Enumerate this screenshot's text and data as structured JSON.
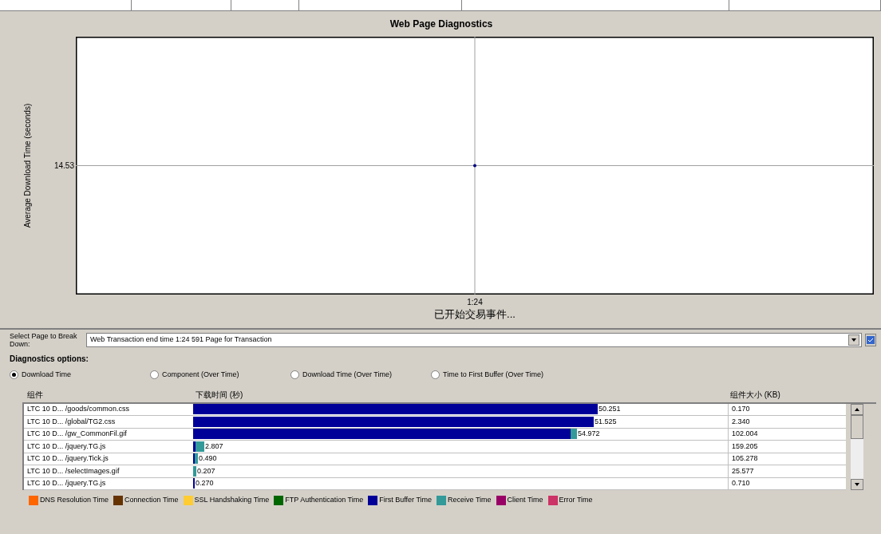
{
  "chart": {
    "title": "Web Page Diagnostics",
    "ylabel": "Average Download Time (seconds)",
    "ytick": "14.53",
    "xtick": "1:24",
    "xlabel": "已开始交易事件..."
  },
  "select_page": {
    "label": "Select Page to Break Down:",
    "value": "Web Transaction end time 1:24 591 Page for Transaction"
  },
  "options": {
    "title": "Diagnostics options:",
    "radios": [
      {
        "label": "Download Time",
        "selected": true
      },
      {
        "label": "Component (Over Time)",
        "selected": false
      },
      {
        "label": "Download Time (Over Time)",
        "selected": false
      },
      {
        "label": "Time to First Buffer (Over Time)",
        "selected": false
      }
    ]
  },
  "table": {
    "columns": [
      "组件",
      "下载时间 (秒)",
      "组件大小 (KB)"
    ],
    "rows": [
      {
        "name": "LTC 10 D... /goods/common.css",
        "segments": [
          {
            "kind": "first_buffer"
          }
        ],
        "time": "50.251",
        "size": "0.170"
      },
      {
        "name": "LTC 10 D... /global/TG2.css",
        "segments": [
          {
            "kind": "first_buffer"
          }
        ],
        "time": "51.525",
        "size": "2.340"
      },
      {
        "name": "LTC 10 D... /gw_CommonFil.gif",
        "segments": [
          {
            "kind": "first_buffer"
          },
          {
            "kind": "receive"
          }
        ],
        "time": "54.972",
        "size": "102.004"
      },
      {
        "name": "LTC 10 D... /jquery.TG.js",
        "segments": [
          {
            "kind": "first_buffer"
          },
          {
            "kind": "receive"
          }
        ],
        "time": "2.807",
        "size": "159.205"
      },
      {
        "name": "LTC 10 D... /jquery.Tick.js",
        "segments": [
          {
            "kind": "first_buffer"
          },
          {
            "kind": "receive"
          }
        ],
        "time": "0.490",
        "size": "105.278"
      },
      {
        "name": "LTC 10 D... /selectImages.gif",
        "segments": [
          {
            "kind": "receive"
          }
        ],
        "time": "0.207",
        "size": "25.577"
      },
      {
        "name": "LTC 10 D... /jquery.TG.js",
        "segments": [
          {
            "kind": "first_buffer"
          }
        ],
        "time": "0.270",
        "size": "0.710"
      }
    ]
  },
  "legend": [
    {
      "label": "DNS Resolution Time",
      "color": "#ff6600"
    },
    {
      "label": "Connection Time",
      "color": "#663300"
    },
    {
      "label": "SSL Handshaking Time",
      "color": "#ffcc33"
    },
    {
      "label": "FTP Authentication Time",
      "color": "#006600"
    },
    {
      "label": "First Buffer Time",
      "color": "#000099"
    },
    {
      "label": "Receive Time",
      "color": "#339999"
    },
    {
      "label": "Client Time",
      "color": "#990066"
    },
    {
      "label": "Error Time",
      "color": "#cc3366"
    }
  ]
}
